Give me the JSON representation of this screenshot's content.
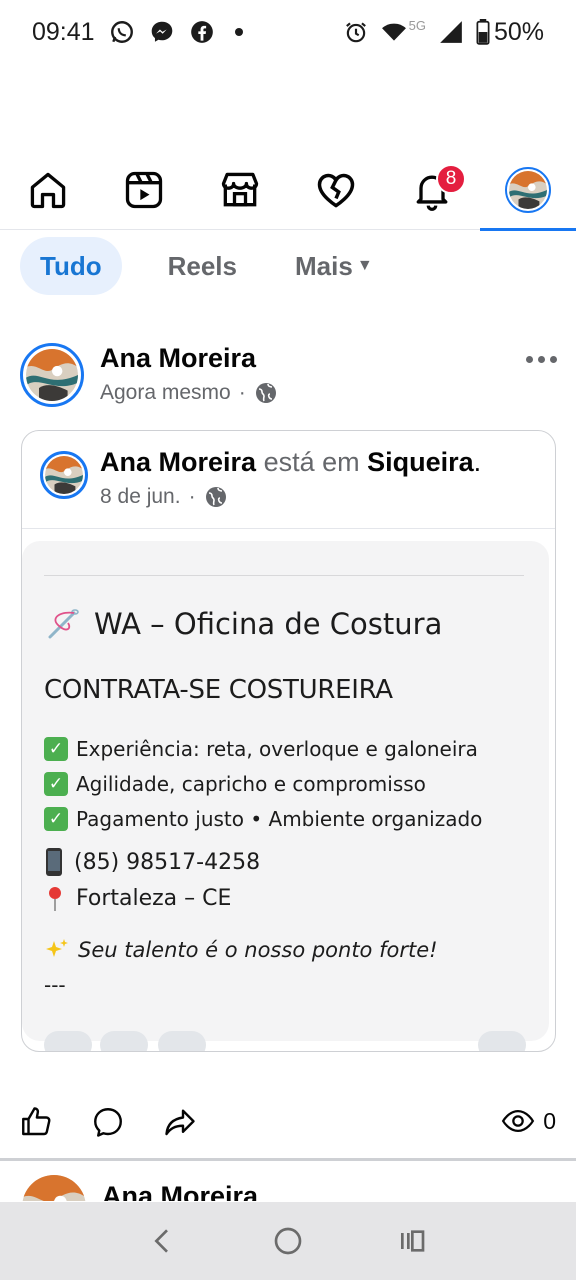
{
  "status_bar": {
    "time": "09:41",
    "network": "5G",
    "battery": "50%"
  },
  "nav": {
    "notification_count": "8"
  },
  "filters": [
    {
      "label": "Tudo",
      "active": true
    },
    {
      "label": "Reels",
      "active": false
    },
    {
      "label": "Mais",
      "active": false
    }
  ],
  "post": {
    "author": "Ana Moreira",
    "time": "Agora mesmo",
    "separator": "·",
    "shared": {
      "author": "Ana Moreira",
      "verb": "está em",
      "place": "Siqueira",
      "period": ".",
      "date": "8 de jun.",
      "separator": "·"
    },
    "content": {
      "title": "WA – Oficina de Costura",
      "subtitle": "CONTRATA-SE COSTUREIRA",
      "items": [
        "Experiência: reta, overloque e galoneira",
        "Agilidade, capricho e compromisso",
        "Pagamento justo • Ambiente organizado"
      ],
      "phone": "(85) 98517-4258",
      "location": "Fortaleza – CE",
      "slogan": "Seu talento é o nosso ponto forte!",
      "dashes": "---"
    },
    "views": "0"
  },
  "next_post": {
    "author": "Ana Moreira"
  },
  "colors": {
    "accent": "#1877f2",
    "badge": "#e41e3f",
    "chip_active_bg": "#e7f0fd"
  }
}
